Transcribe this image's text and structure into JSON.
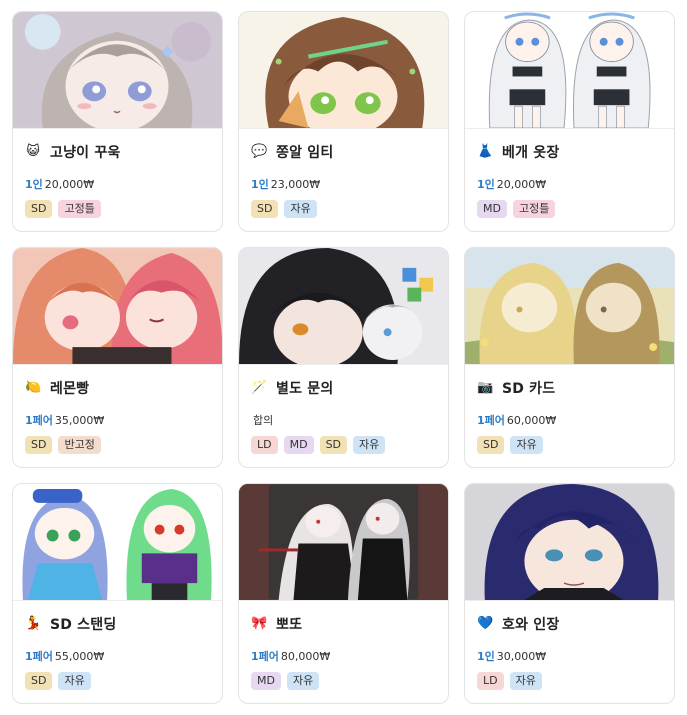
{
  "products": [
    {
      "emoji": "😺",
      "title": "고냥이 꾸욱",
      "unit": "1인",
      "price": "20,000₩",
      "tags": [
        {
          "label": "SD",
          "kind": "sd"
        },
        {
          "label": "고정틀",
          "kind": "fixed"
        }
      ],
      "art": "art-girl-lavender"
    },
    {
      "emoji": "💬",
      "title": "쫑알 임티",
      "unit": "1인",
      "price": "23,000₩",
      "tags": [
        {
          "label": "SD",
          "kind": "sd"
        },
        {
          "label": "자유",
          "kind": "free"
        }
      ],
      "art": "art-boy-brown"
    },
    {
      "emoji": "👗",
      "title": "베개 옷장",
      "unit": "1인",
      "price": "20,000₩",
      "tags": [
        {
          "label": "MD",
          "kind": "md"
        },
        {
          "label": "고정틀",
          "kind": "fixed"
        }
      ],
      "art": "art-twin-white"
    },
    {
      "emoji": "🍋",
      "title": "레몬빵",
      "unit": "1페어",
      "price": "35,000₩",
      "tags": [
        {
          "label": "SD",
          "kind": "sd"
        },
        {
          "label": "반고정",
          "kind": "semi"
        }
      ],
      "art": "art-pair-pink"
    },
    {
      "emoji": "🪄",
      "title": "별도 문의",
      "unit": "",
      "price": "합의",
      "tags": [
        {
          "label": "LD",
          "kind": "ld"
        },
        {
          "label": "MD",
          "kind": "md"
        },
        {
          "label": "SD",
          "kind": "sd"
        },
        {
          "label": "자유",
          "kind": "free"
        }
      ],
      "art": "art-dark-hair"
    },
    {
      "emoji": "📷",
      "title": "SD 카드",
      "unit": "1페어",
      "price": "60,000₩",
      "tags": [
        {
          "label": "SD",
          "kind": "sd"
        },
        {
          "label": "자유",
          "kind": "free"
        }
      ],
      "art": "art-pair-gold"
    },
    {
      "emoji": "💃",
      "title": "SD 스탠딩",
      "unit": "1페어",
      "price": "55,000₩",
      "tags": [
        {
          "label": "SD",
          "kind": "sd"
        },
        {
          "label": "자유",
          "kind": "free"
        }
      ],
      "art": "art-chibi-blue-green"
    },
    {
      "emoji": "🎀",
      "title": "뽀또",
      "unit": "1페어",
      "price": "80,000₩",
      "tags": [
        {
          "label": "MD",
          "kind": "md"
        },
        {
          "label": "자유",
          "kind": "free"
        }
      ],
      "art": "art-gothic-pair"
    },
    {
      "emoji": "💙",
      "title": "호와 인장",
      "unit": "1인",
      "price": "30,000₩",
      "tags": [
        {
          "label": "LD",
          "kind": "ld"
        },
        {
          "label": "자유",
          "kind": "free"
        }
      ],
      "art": "art-navy-hair"
    }
  ]
}
